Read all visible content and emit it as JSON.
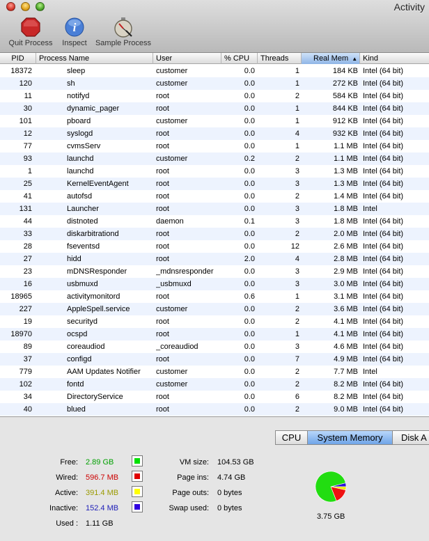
{
  "window": {
    "title": "Activity"
  },
  "toolbar": {
    "items": [
      {
        "label": "Quit Process",
        "icon": "stop-sign-icon"
      },
      {
        "label": "Inspect",
        "icon": "info-icon"
      },
      {
        "label": "Sample Process",
        "icon": "stopwatch-icon"
      }
    ]
  },
  "table": {
    "columns": [
      "PID",
      "Process Name",
      "User",
      "% CPU",
      "Threads",
      "Real Mem",
      "Kind"
    ],
    "sorted_column": "Real Mem",
    "sort_direction": "ascending",
    "rows": [
      {
        "pid": "18372",
        "name": "sleep",
        "user": "customer",
        "cpu": "0.0",
        "threads": "1",
        "mem": "184 KB",
        "kind": "Intel (64 bit)"
      },
      {
        "pid": "120",
        "name": "sh",
        "user": "customer",
        "cpu": "0.0",
        "threads": "1",
        "mem": "272 KB",
        "kind": "Intel (64 bit)"
      },
      {
        "pid": "11",
        "name": "notifyd",
        "user": "root",
        "cpu": "0.0",
        "threads": "2",
        "mem": "584 KB",
        "kind": "Intel (64 bit)"
      },
      {
        "pid": "30",
        "name": "dynamic_pager",
        "user": "root",
        "cpu": "0.0",
        "threads": "1",
        "mem": "844 KB",
        "kind": "Intel (64 bit)"
      },
      {
        "pid": "101",
        "name": "pboard",
        "user": "customer",
        "cpu": "0.0",
        "threads": "1",
        "mem": "912 KB",
        "kind": "Intel (64 bit)"
      },
      {
        "pid": "12",
        "name": "syslogd",
        "user": "root",
        "cpu": "0.0",
        "threads": "4",
        "mem": "932 KB",
        "kind": "Intel (64 bit)"
      },
      {
        "pid": "77",
        "name": "cvmsServ",
        "user": "root",
        "cpu": "0.0",
        "threads": "1",
        "mem": "1.1 MB",
        "kind": "Intel (64 bit)"
      },
      {
        "pid": "93",
        "name": "launchd",
        "user": "customer",
        "cpu": "0.2",
        "threads": "2",
        "mem": "1.1 MB",
        "kind": "Intel (64 bit)"
      },
      {
        "pid": "1",
        "name": "launchd",
        "user": "root",
        "cpu": "0.0",
        "threads": "3",
        "mem": "1.3 MB",
        "kind": "Intel (64 bit)"
      },
      {
        "pid": "25",
        "name": "KernelEventAgent",
        "user": "root",
        "cpu": "0.0",
        "threads": "3",
        "mem": "1.3 MB",
        "kind": "Intel (64 bit)"
      },
      {
        "pid": "41",
        "name": "autofsd",
        "user": "root",
        "cpu": "0.0",
        "threads": "2",
        "mem": "1.4 MB",
        "kind": "Intel (64 bit)"
      },
      {
        "pid": "131",
        "name": "Launcher",
        "user": "root",
        "cpu": "0.0",
        "threads": "3",
        "mem": "1.8 MB",
        "kind": "Intel"
      },
      {
        "pid": "44",
        "name": "distnoted",
        "user": "daemon",
        "cpu": "0.1",
        "threads": "3",
        "mem": "1.8 MB",
        "kind": "Intel (64 bit)"
      },
      {
        "pid": "33",
        "name": "diskarbitrationd",
        "user": "root",
        "cpu": "0.0",
        "threads": "2",
        "mem": "2.0 MB",
        "kind": "Intel (64 bit)"
      },
      {
        "pid": "28",
        "name": "fseventsd",
        "user": "root",
        "cpu": "0.0",
        "threads": "12",
        "mem": "2.6 MB",
        "kind": "Intel (64 bit)"
      },
      {
        "pid": "27",
        "name": "hidd",
        "user": "root",
        "cpu": "2.0",
        "threads": "4",
        "mem": "2.8 MB",
        "kind": "Intel (64 bit)"
      },
      {
        "pid": "23",
        "name": "mDNSResponder",
        "user": "_mdnsresponder",
        "cpu": "0.0",
        "threads": "3",
        "mem": "2.9 MB",
        "kind": "Intel (64 bit)"
      },
      {
        "pid": "16",
        "name": "usbmuxd",
        "user": "_usbmuxd",
        "cpu": "0.0",
        "threads": "3",
        "mem": "3.0 MB",
        "kind": "Intel (64 bit)"
      },
      {
        "pid": "18965",
        "name": "activitymonitord",
        "user": "root",
        "cpu": "0.6",
        "threads": "1",
        "mem": "3.1 MB",
        "kind": "Intel (64 bit)"
      },
      {
        "pid": "227",
        "name": "AppleSpell.service",
        "user": "customer",
        "cpu": "0.0",
        "threads": "2",
        "mem": "3.6 MB",
        "kind": "Intel (64 bit)"
      },
      {
        "pid": "19",
        "name": "securityd",
        "user": "root",
        "cpu": "0.0",
        "threads": "2",
        "mem": "4.1 MB",
        "kind": "Intel (64 bit)"
      },
      {
        "pid": "18970",
        "name": "ocspd",
        "user": "root",
        "cpu": "0.0",
        "threads": "1",
        "mem": "4.1 MB",
        "kind": "Intel (64 bit)"
      },
      {
        "pid": "89",
        "name": "coreaudiod",
        "user": "_coreaudiod",
        "cpu": "0.0",
        "threads": "3",
        "mem": "4.6 MB",
        "kind": "Intel (64 bit)"
      },
      {
        "pid": "37",
        "name": "configd",
        "user": "root",
        "cpu": "0.0",
        "threads": "7",
        "mem": "4.9 MB",
        "kind": "Intel (64 bit)"
      },
      {
        "pid": "779",
        "name": "AAM Updates Notifier",
        "user": "customer",
        "cpu": "0.0",
        "threads": "2",
        "mem": "7.7 MB",
        "kind": "Intel"
      },
      {
        "pid": "102",
        "name": "fontd",
        "user": "customer",
        "cpu": "0.0",
        "threads": "2",
        "mem": "8.2 MB",
        "kind": "Intel (64 bit)"
      },
      {
        "pid": "34",
        "name": "DirectoryService",
        "user": "root",
        "cpu": "0.0",
        "threads": "6",
        "mem": "8.2 MB",
        "kind": "Intel (64 bit)"
      },
      {
        "pid": "40",
        "name": "blued",
        "user": "root",
        "cpu": "0.0",
        "threads": "2",
        "mem": "9.0 MB",
        "kind": "Intel (64 bit)"
      }
    ]
  },
  "tabs": [
    {
      "label": "CPU",
      "active": false
    },
    {
      "label": "System Memory",
      "active": true
    },
    {
      "label": "Disk A",
      "active": false
    }
  ],
  "memory": {
    "free": {
      "label": "Free:",
      "value": "2.89 GB",
      "color": "#00c000",
      "swatch": "#00e000"
    },
    "wired": {
      "label": "Wired:",
      "value": "596.7 MB",
      "color": "#d00000",
      "swatch": "#e00000"
    },
    "active": {
      "label": "Active:",
      "value": "391.4 MB",
      "color": "#a0a000",
      "swatch": "#ffff00"
    },
    "inactive": {
      "label": "Inactive:",
      "value": "152.4 MB",
      "color": "#2020c0",
      "swatch": "#3000e0"
    },
    "used": {
      "label": "Used :",
      "value": "1.11 GB"
    },
    "vm_size": {
      "label": "VM size:",
      "value": "104.53 GB"
    },
    "page_ins": {
      "label": "Page ins:",
      "value": "4.74 GB"
    },
    "page_outs": {
      "label": "Page outs:",
      "value": "0 bytes"
    },
    "swap_used": {
      "label": "Swap used:",
      "value": "0 bytes"
    },
    "total": "3.75 GB",
    "pie": [
      {
        "name": "free",
        "fraction": 0.77,
        "color": "#22dd11"
      },
      {
        "name": "wired",
        "fraction": 0.155,
        "color": "#ee1111"
      },
      {
        "name": "active",
        "fraction": 0.035,
        "color": "#eeee00"
      },
      {
        "name": "inactive",
        "fraction": 0.04,
        "color": "#2a10d8"
      }
    ]
  }
}
